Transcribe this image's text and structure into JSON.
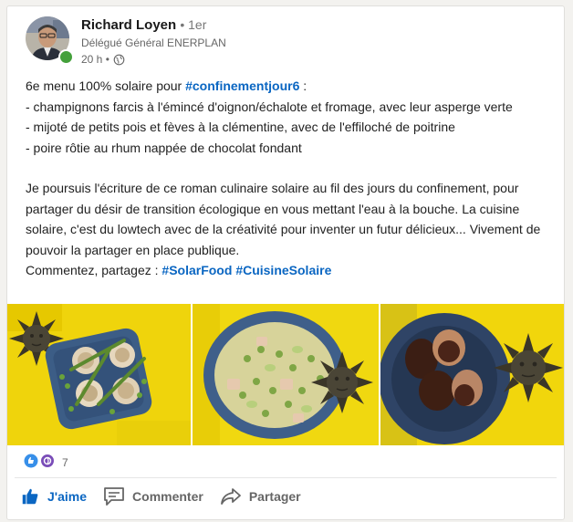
{
  "author": {
    "name": "Richard Loyen",
    "degree": "• 1er",
    "headline": "Délégué Général ENERPLAN",
    "time": "20 h •",
    "visibility_icon": "globe-icon"
  },
  "post": {
    "line1_text": "6e menu 100% solaire pour ",
    "line1_hashtag": "#confinementjour6",
    "line1_end": " :",
    "item1": "- champignons farcis à l'émincé d'oignon/échalote et fromage, avec leur asperge verte",
    "item2": "- mijoté de petits pois et fèves à la clémentine, avec de l'effiloché de poitrine",
    "item3": "- poire rôtie au rhum nappée de chocolat fondant",
    "paragraph": "Je poursuis l'écriture de ce roman culinaire solaire au fil des jours du confinement, pour partager du désir de transition écologique en vous mettant l'eau à la bouche. La cuisine solaire, c'est du lowtech avec de la créativité pour inventer un futur délicieux... Vivement de pouvoir la partager en place publique.",
    "cta": "Commentez, partagez : ",
    "hashtag1": "#SolarFood",
    "hashtag2": "#CuisineSolaire"
  },
  "reactions": {
    "count": "7",
    "icons": [
      "like-reaction-icon",
      "celebrate-reaction-icon"
    ]
  },
  "actions": {
    "like": "J'aime",
    "comment": "Commenter",
    "share": "Partager"
  },
  "colors": {
    "accent": "#0a66c2",
    "yellow": "#f2dd10",
    "plate": "#3d5a80"
  }
}
